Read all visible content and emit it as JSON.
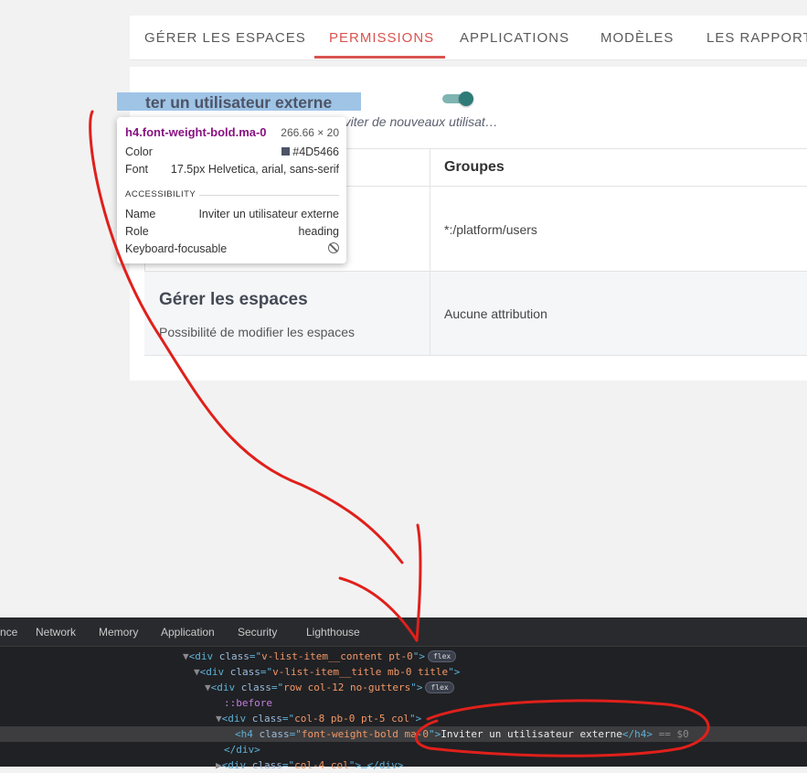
{
  "tabs": [
    {
      "label": "GÉRER LES ESPACES"
    },
    {
      "label": "PERMISSIONS"
    },
    {
      "label": "APPLICATIONS"
    },
    {
      "label": "MODÈLES"
    },
    {
      "label": "LES RAPPORT"
    }
  ],
  "active_tab": "PERMISSIONS",
  "setting": {
    "title_visible": "ter un utilisateur externe",
    "subtitle": "Autoriser/Interdire la possibilité d'inviter de nouveaux utilisat…",
    "toggle_on": true
  },
  "table": {
    "header_groupes": "Groupes",
    "rows": [
      {
        "groupes": "*:/platform/users"
      },
      {
        "name": "Gérer les espaces",
        "description": "Possibilité de modifier les espaces",
        "groupes": "Aucune attribution"
      }
    ]
  },
  "tooltip": {
    "selector": "h4.font-weight-bold.ma-0",
    "size": "266.66 × 20",
    "color_label": "Color",
    "color_value": "#4D5466",
    "font_label": "Font",
    "font_value": "17.5px Helvetica, arial, sans-serif",
    "accessibility_label": "ACCESSIBILITY",
    "name_label": "Name",
    "name_value": "Inviter un utilisateur externe",
    "role_label": "Role",
    "role_value": "heading",
    "focusable_label": "Keyboard-focusable"
  },
  "devtools": {
    "tabs": [
      "nce",
      "Network",
      "Memory",
      "Application",
      "Security",
      "Lighthouse"
    ],
    "lines": [
      {
        "tag": "div",
        "cls": "v-list-item__content pt-0",
        "badge": "flex"
      },
      {
        "tag": "div",
        "cls": "v-list-item__title mb-0 title"
      },
      {
        "tag": "div",
        "cls": "row col-12 no-gutters",
        "badge": "flex"
      },
      {
        "pseudo": "::before"
      },
      {
        "tag": "div",
        "cls": "col-8 pb-0 pt-5 col"
      },
      {
        "tag": "h4",
        "cls": "font-weight-bold ma-0",
        "text": "Inviter un utilisateur externe",
        "suffix": "== $0"
      },
      {
        "close": "</div>"
      },
      {
        "tag": "div",
        "cls": "col-4 col"
      }
    ]
  },
  "colors": {
    "accent": "#d9534f",
    "heading": "#4D5466",
    "toggle": "#2f7b78",
    "annotation": "#e0201b"
  }
}
